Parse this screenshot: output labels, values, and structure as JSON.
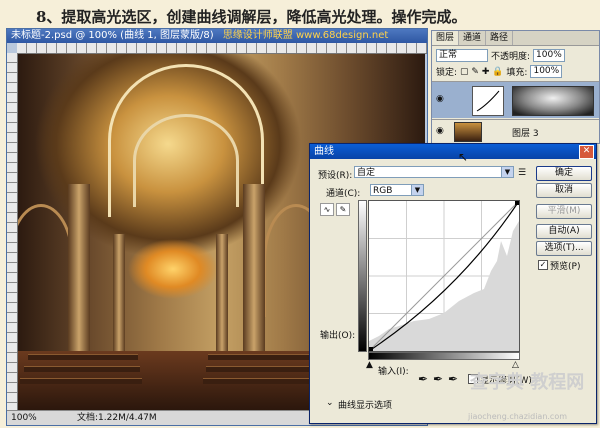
{
  "headline": "8、提取高光选区，创建曲线调解层，降低高光处理。操作完成。",
  "document": {
    "title": "未标题-2.psd @ 100% (曲线 1, 图层蒙版/8)",
    "title_watermark": "思缘设计师联盟 www.68design.net",
    "status_zoom": "100%",
    "status_doc": "文档:1.22M/4.47M"
  },
  "layers_panel": {
    "tabs": [
      "图层",
      "通道",
      "路径"
    ],
    "blend_mode": "正常",
    "opacity_label": "不透明度:",
    "opacity_value": "100%",
    "lock_label": "锁定:",
    "fill_label": "填充:",
    "fill_value": "100%",
    "layer2_name": "图层 3"
  },
  "curves_dialog": {
    "title": "曲线",
    "preset_label": "预设(R):",
    "preset_value": "自定",
    "channel_label": "通道(C):",
    "channel_value": "RGB",
    "output_label": "输出(O):",
    "input_label": "输入(I):",
    "show_clipping_label": "显示修剪(W)",
    "display_options_label": "曲线显示选项",
    "buttons": {
      "ok": "确定",
      "cancel": "取消",
      "smooth": "平滑(M)",
      "auto": "自动(A)",
      "options": "选项(T)..."
    },
    "preview_label": "预览(P)",
    "preview_checked": true
  },
  "watermark": {
    "text": "查字典 教程网",
    "url": "jiaocheng.chazidian.com"
  },
  "colors": {
    "titlebar": "#0a5ed6",
    "dialog_bg": "#ece9d8",
    "curve": "#000000"
  }
}
